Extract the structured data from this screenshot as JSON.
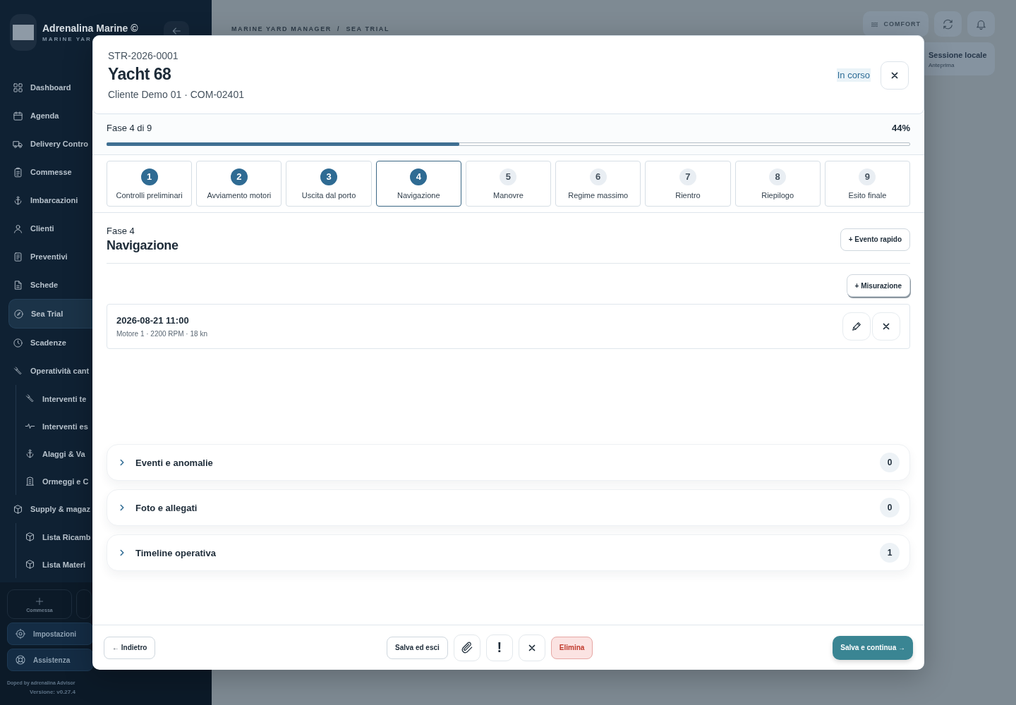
{
  "sidebar": {
    "brand": {
      "name": "Adrenalina Marine ©",
      "subtitle": "MARINE YAR"
    },
    "items": [
      {
        "label": "Dashboard",
        "selected": false
      },
      {
        "label": "Agenda",
        "selected": false
      },
      {
        "label": "Delivery Contro",
        "selected": false
      },
      {
        "label": "Commesse",
        "selected": false
      },
      {
        "label": "Imbarcazioni",
        "selected": false
      },
      {
        "label": "Clienti",
        "selected": false
      },
      {
        "label": "Preventivi",
        "selected": false
      },
      {
        "label": "Schede",
        "selected": false
      },
      {
        "label": "Sea Trial",
        "selected": true
      },
      {
        "label": "Scadenze",
        "selected": false
      },
      {
        "label": "Operatività cant",
        "selected": false,
        "children": [
          {
            "label": "Interventi te",
            "selected": false
          },
          {
            "label": "Interventi es",
            "selected": false
          },
          {
            "label": "Alaggi & Va",
            "selected": false
          },
          {
            "label": "Ormeggi e C",
            "selected": false
          }
        ]
      },
      {
        "label": "Supply & magaz",
        "selected": false,
        "children": [
          {
            "label": "Lista Ricamb",
            "selected": false
          },
          {
            "label": "Lista Materi",
            "selected": false
          }
        ]
      }
    ],
    "quick_action": "Commessa",
    "footer_links": [
      {
        "label": "Impostazioni"
      },
      {
        "label": "Assistenza"
      }
    ],
    "credit": "Doped by adrenalina Advisor",
    "version": "Versione: v0.27.4"
  },
  "topbar": {
    "breadcrumb": "MARINE YARD MANAGER  /  SEA TRIAL",
    "density": "COMFORT",
    "session": {
      "title": "Sessione locale",
      "subtitle": "Anteprima"
    }
  },
  "modal": {
    "code": "STR-2026-0001",
    "title": "Yacht 68",
    "subtitle": "Cliente Demo 01 · COM-02401",
    "status": "In corso",
    "progress": {
      "label": "Fase 4 di 9",
      "percent": "44%",
      "level": 0.44
    },
    "steps": [
      {
        "number": "1",
        "label": "Controlli preliminari",
        "done": true,
        "selected": false
      },
      {
        "number": "2",
        "label": "Avviamento motori",
        "done": true,
        "selected": false
      },
      {
        "number": "3",
        "label": "Uscita dal porto",
        "done": true,
        "selected": false
      },
      {
        "number": "4",
        "label": "Navigazione",
        "done": false,
        "selected": true
      },
      {
        "number": "5",
        "label": "Manovre",
        "done": false,
        "selected": false
      },
      {
        "number": "6",
        "label": "Regime massimo",
        "done": false,
        "selected": false
      },
      {
        "number": "7",
        "label": "Rientro",
        "done": false,
        "selected": false
      },
      {
        "number": "8",
        "label": "Riepilogo",
        "done": false,
        "selected": false
      },
      {
        "number": "9",
        "label": "Esito finale",
        "done": false,
        "selected": false
      }
    ],
    "phase": {
      "overline": "Fase 4",
      "title": "Navigazione",
      "quick_event": "+ Evento rapido",
      "add_measurement": "+ Misurazione"
    },
    "measurements": [
      {
        "time": "2026-08-21 11:00",
        "detail": "Motore 1 · 2200 RPM · 18 kn"
      }
    ],
    "sections": [
      {
        "title": "Eventi e anomalie",
        "count": "0",
        "expanded": false
      },
      {
        "title": "Foto e allegati",
        "count": "0",
        "expanded": false
      },
      {
        "title": "Timeline operativa",
        "count": "1",
        "expanded": false
      }
    ],
    "footer": {
      "back": "← Indietro",
      "save_exit": "Salva ed esci",
      "alert": "!",
      "delete": "Elimina",
      "save_continue": "Salva e continua →"
    }
  }
}
